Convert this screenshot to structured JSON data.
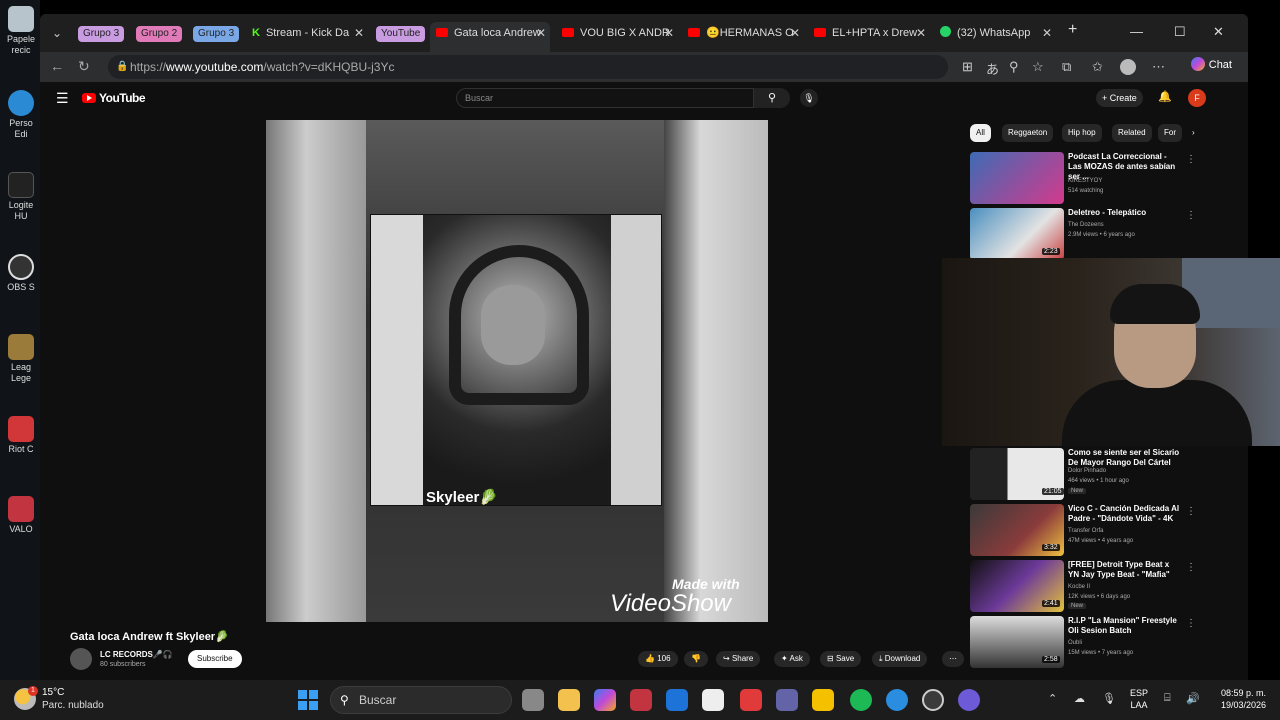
{
  "desktop": {
    "icons": [
      {
        "label": "Papele recic",
        "color": "#b8c4cc"
      },
      {
        "label": "Perso Edi",
        "color": "#2a8bd4"
      },
      {
        "label": "Logite HU",
        "color": "#222"
      },
      {
        "label": "OBS S",
        "color": "#333"
      },
      {
        "label": "Leag Lege",
        "color": "#9b7b3a"
      },
      {
        "label": "Riot C",
        "color": "#d13639"
      },
      {
        "label": "VALO",
        "color": "#c23440"
      }
    ]
  },
  "tabs": {
    "groups": [
      {
        "label": "Grupo 3",
        "color": "#c99be0"
      },
      {
        "label": "Grupo 2",
        "color": "#e07ab8"
      },
      {
        "label": "Grupo 3",
        "color": "#7aa7e6"
      }
    ],
    "kick_tab": "Stream - Kick Da",
    "youtube_group": "YouTube",
    "items": [
      "Gata loca Andrew",
      "VOU BIG X ANDR",
      "😐HERMANAS O",
      "EL+HPTA x Drew",
      "(32) WhatsApp"
    ]
  },
  "address": {
    "url_prefix": "https://",
    "url_host": "www.youtube.com",
    "url_path": "/watch?v=dKHQBU-j3Yc",
    "chat_label": "Chat"
  },
  "youtube": {
    "logo": "YouTube",
    "search_placeholder": "Buscar",
    "create_label": "+ Create",
    "avatar_letter": "F",
    "video": {
      "overlay_name": "Skyleer🥬",
      "watermark_top": "Made with",
      "watermark_bottom": "VideoShow",
      "title": "Gata loca Andrew ft Skyleer🥬",
      "channel": "LC RECORDS🎤🎧",
      "subscribers": "80 subscribers",
      "subscribe_label": "Subscribe",
      "likes": "106",
      "share_label": "Share",
      "ask_label": "Ask",
      "save_label": "Save",
      "download_label": "Download"
    },
    "chips": [
      "All",
      "Reggaeton",
      "Hip hop",
      "Related",
      "For"
    ],
    "recommendations": [
      {
        "title": "Podcast La Correccional - Las MOZAS de antes sabían ser ...",
        "channel": "KIRESTYOY",
        "meta": "514 watching",
        "duration": "",
        "color": "#3d6bb5"
      },
      {
        "title": "Deletreo - Telepático",
        "channel": "The Dozeens",
        "meta": "2.9M views • 6 years ago",
        "duration": "2:23",
        "color": "#4a8fbf"
      },
      {
        "title": "Como se siente ser el Sicario De Mayor Rango Del Cártel",
        "channel": "Dolor Pinhado",
        "meta": "464 views • 1 hour ago",
        "duration": "21:05",
        "tag": "New",
        "color": "#d8d8d8"
      },
      {
        "title": "Vico C - Canción Dedicada Al Padre - \"Dándote Vida\" - 4K",
        "channel": "Transfer Orfa",
        "meta": "47M views • 4 years ago",
        "duration": "3:32",
        "color": "#8a3b3b"
      },
      {
        "title": "[FREE] Detroit Type Beat x YN Jay Type Beat - \"Mafia\"",
        "channel": "Kocbe II",
        "meta": "12K views • 6 days ago",
        "duration": "2:41",
        "tag": "New",
        "color": "#6c3a99"
      },
      {
        "title": "R.I.P \"La Mansion\" Freestyle Oli Sesion Batch",
        "channel": "Oubli",
        "meta": "15M views • 7 years ago",
        "duration": "2:58",
        "color": "#9a9a9a"
      }
    ]
  },
  "taskbar": {
    "temperature": "15°C",
    "condition": "Parc. nublado",
    "search_placeholder": "Buscar",
    "lang_top": "ESP",
    "lang_bottom": "LAA",
    "time": "08:59 p. m.",
    "date": "19/03/2026",
    "apps": [
      {
        "name": "task-view-app",
        "color": "#888"
      },
      {
        "name": "file-explorer-app",
        "color": "#f2c14e"
      },
      {
        "name": "copilot-app",
        "color": "#7a5cf0"
      },
      {
        "name": "valorant-app",
        "color": "#c23440"
      },
      {
        "name": "outlook-app",
        "color": "#1e73d8"
      },
      {
        "name": "store-app",
        "color": "#eee"
      },
      {
        "name": "riot-app",
        "color": "#e03a3a"
      },
      {
        "name": "teams-app",
        "color": "#6264a7"
      },
      {
        "name": "sticky-app",
        "color": "#f4c000"
      },
      {
        "name": "spotify-app",
        "color": "#1db954"
      },
      {
        "name": "edge-app",
        "color": "#2b8de0"
      },
      {
        "name": "obs-app",
        "color": "#3b3b3b"
      },
      {
        "name": "discord-app",
        "color": "#6d5ad6"
      }
    ]
  }
}
